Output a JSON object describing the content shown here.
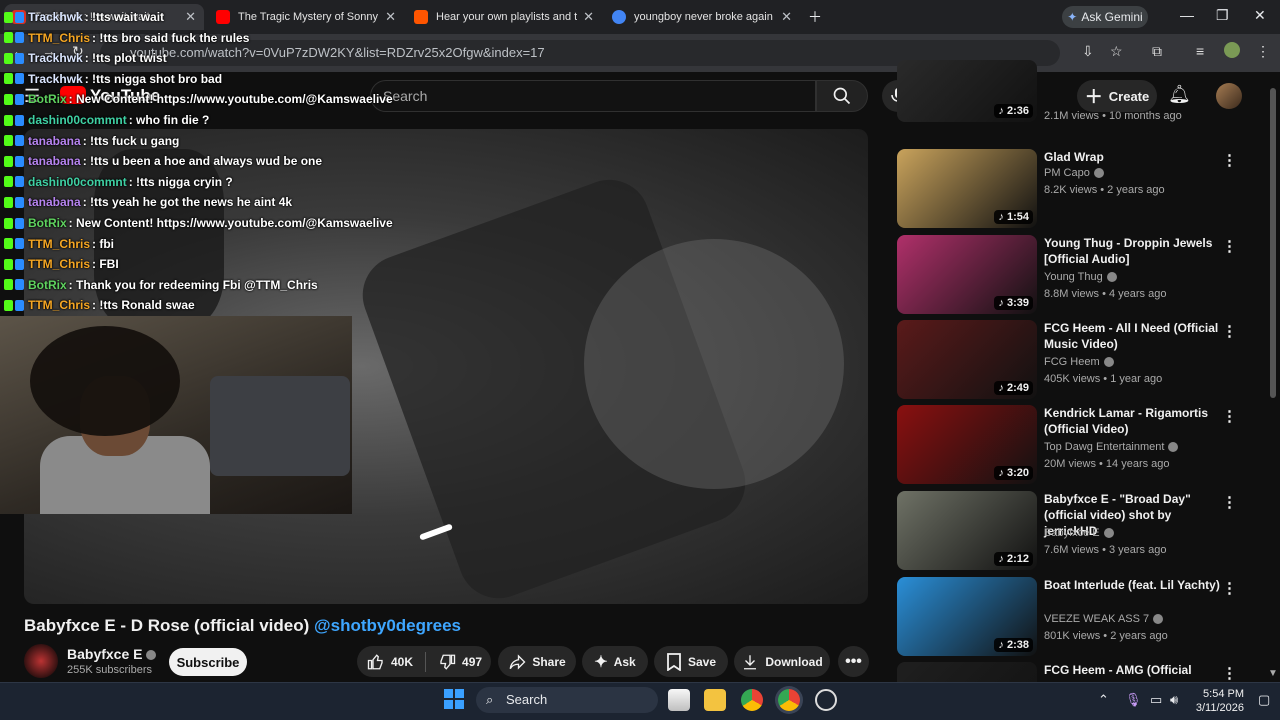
{
  "browser": {
    "tabs": [
      {
        "title": "Trackhwk : !tts wait wait",
        "favicon_color": "#d93025"
      },
      {
        "title": "The Tragic Mystery of Sonny Lis",
        "favicon_color": "#ff0000"
      },
      {
        "title": "Hear your own playlists and the",
        "favicon_color": "#ff5500"
      },
      {
        "title": "youngboy never broke again ai",
        "favicon_color": "#4285f4"
      }
    ],
    "ask_gemini": "Ask Gemini",
    "url": "youtube.com/watch?v=0VuP7zDW2KY&list=RDZrv25x2Ofgw&index=17"
  },
  "header": {
    "logo": "YouTube",
    "search_placeholder": "Search",
    "create_label": "Create"
  },
  "chat": [
    {
      "user": "Trackhwk",
      "msg": ": !tts wait wait",
      "color": "#dbe6ff"
    },
    {
      "user": "TTM_Chris",
      "msg": ": !tts bro said fuck the rules",
      "color": "#f5a623"
    },
    {
      "user": "Trackhwk",
      "msg": ": !tts plot twist",
      "color": "#dbe6ff"
    },
    {
      "user": "Trackhwk",
      "msg": ": !tts nigga shot bro bad",
      "color": "#dbe6ff"
    },
    {
      "user": "BotRix",
      "msg": ": New Content! https://www.youtube.com/@Kamswaelive",
      "color": "#5fd35f"
    },
    {
      "user": "dashin00commnt",
      "msg": ": who fin die ?",
      "color": "#3fd1a4"
    },
    {
      "user": "tanabana",
      "msg": ": !tts fuck u gang",
      "color": "#b784f0"
    },
    {
      "user": "tanabana",
      "msg": ": !tts u been a hoe and always wud be one",
      "color": "#b784f0"
    },
    {
      "user": "dashin00commnt",
      "msg": ": !tts nigga cryin ?",
      "color": "#3fd1a4"
    },
    {
      "user": "tanabana",
      "msg": ": !tts yeah he got the news he aint 4k",
      "color": "#b784f0"
    },
    {
      "user": "BotRix",
      "msg": ": New Content! https://www.youtube.com/@Kamswaelive",
      "color": "#5fd35f"
    },
    {
      "user": "TTM_Chris",
      "msg": ": fbi",
      "color": "#f5a623"
    },
    {
      "user": "TTM_Chris",
      "msg": ": FBI",
      "color": "#f5a623"
    },
    {
      "user": "BotRix",
      "msg": ": Thank you for redeeming Fbi @TTM_Chris",
      "color": "#5fd35f"
    },
    {
      "user": "TTM_Chris",
      "msg": ": !tts Ronald swae",
      "color": "#f5a623"
    }
  ],
  "video": {
    "title": "Babyfxce E - D Rose (official video)",
    "title_tag": "@shotby0degrees",
    "channel": "Babyfxce E",
    "subscribers": "255K subscribers",
    "subscribe_label": "Subscribe",
    "likes": "40K",
    "dislikes": "497",
    "share_label": "Share",
    "ask_label": "Ask",
    "save_label": "Save",
    "download_label": "Download"
  },
  "recommendations": [
    {
      "title": "",
      "channel": "",
      "meta": "2.1M views • 10 months ago",
      "duration": "2:36",
      "thumb_color": "#2a2a2a"
    },
    {
      "title": "Glad Wrap",
      "channel": "PM Capo",
      "meta": "8.2K views • 2 years ago",
      "duration": "1:54",
      "thumb_color": "#c9a35c"
    },
    {
      "title": "Young Thug - Droppin Jewels [Official Audio]",
      "channel": "Young Thug",
      "meta": "8.8M views • 4 years ago",
      "duration": "3:39",
      "thumb_color": "#b0306a"
    },
    {
      "title": "FCG Heem - All I Need (Official Music Video)",
      "channel": "FCG Heem",
      "meta": "405K views • 1 year ago",
      "duration": "2:49",
      "thumb_color": "#5a1a1a"
    },
    {
      "title": "Kendrick Lamar - Rigamortis (Official Video)",
      "channel": "Top Dawg Entertainment",
      "meta": "20M views • 14 years ago",
      "duration": "3:20",
      "thumb_color": "#8a1010"
    },
    {
      "title": "Babyfxce E - \"Broad Day\" (official video) shot by jerrickHD",
      "channel": "Babyfxce E",
      "meta": "7.6M views • 3 years ago",
      "duration": "2:12",
      "thumb_color": "#6f7266"
    },
    {
      "title": "Boat Interlude (feat. Lil Yachty)",
      "channel": "VEEZE WEAK ASS 7",
      "meta": "801K views • 2 years ago",
      "duration": "2:38",
      "thumb_color": "#2a8fd8"
    },
    {
      "title": "FCG Heem - AMG (Official",
      "channel": "",
      "meta": "",
      "duration": "",
      "thumb_color": "#1f1f1f"
    }
  ],
  "taskbar": {
    "search_label": "Search",
    "time": "5:54 PM",
    "date": "3/11/2026"
  }
}
